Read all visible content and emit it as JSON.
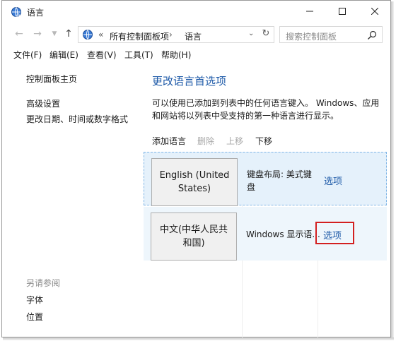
{
  "window": {
    "title": "语言"
  },
  "address_bar": {
    "separator": "«",
    "crumbs": [
      "所有控制面板项",
      "语言"
    ],
    "arrow": "›",
    "search_placeholder": "搜索控制面板"
  },
  "menu": [
    "文件(F)",
    "编辑(E)",
    "查看(V)",
    "工具(T)",
    "帮助(H)"
  ],
  "sidebar": {
    "links": [
      "控制面板主页",
      "高级设置",
      "更改日期、时间或数字格式"
    ],
    "see_also_heading": "另请参阅",
    "see_also_links": [
      "字体",
      "位置"
    ]
  },
  "main": {
    "title": "更改语言首选项",
    "description": "可以使用已添加到列表中的任何语言键入。 Windows、应用和网站将以列表中受支持的第一种语言进行显示。",
    "toolbar": {
      "add": "添加语言",
      "remove": "删除",
      "up": "上移",
      "down": "下移"
    },
    "languages": [
      {
        "name": "English (United States)",
        "info": "键盘布局: 美式键盘",
        "options": "选项",
        "selected": true
      },
      {
        "name": "中文(中华人民共和国)",
        "info": "Windows 显示语...",
        "options": "选项",
        "selected": false
      }
    ]
  },
  "colors": {
    "link_blue": "#1e5aa8",
    "selection": "#e5f1fb",
    "highlight_red": "#d32020"
  }
}
